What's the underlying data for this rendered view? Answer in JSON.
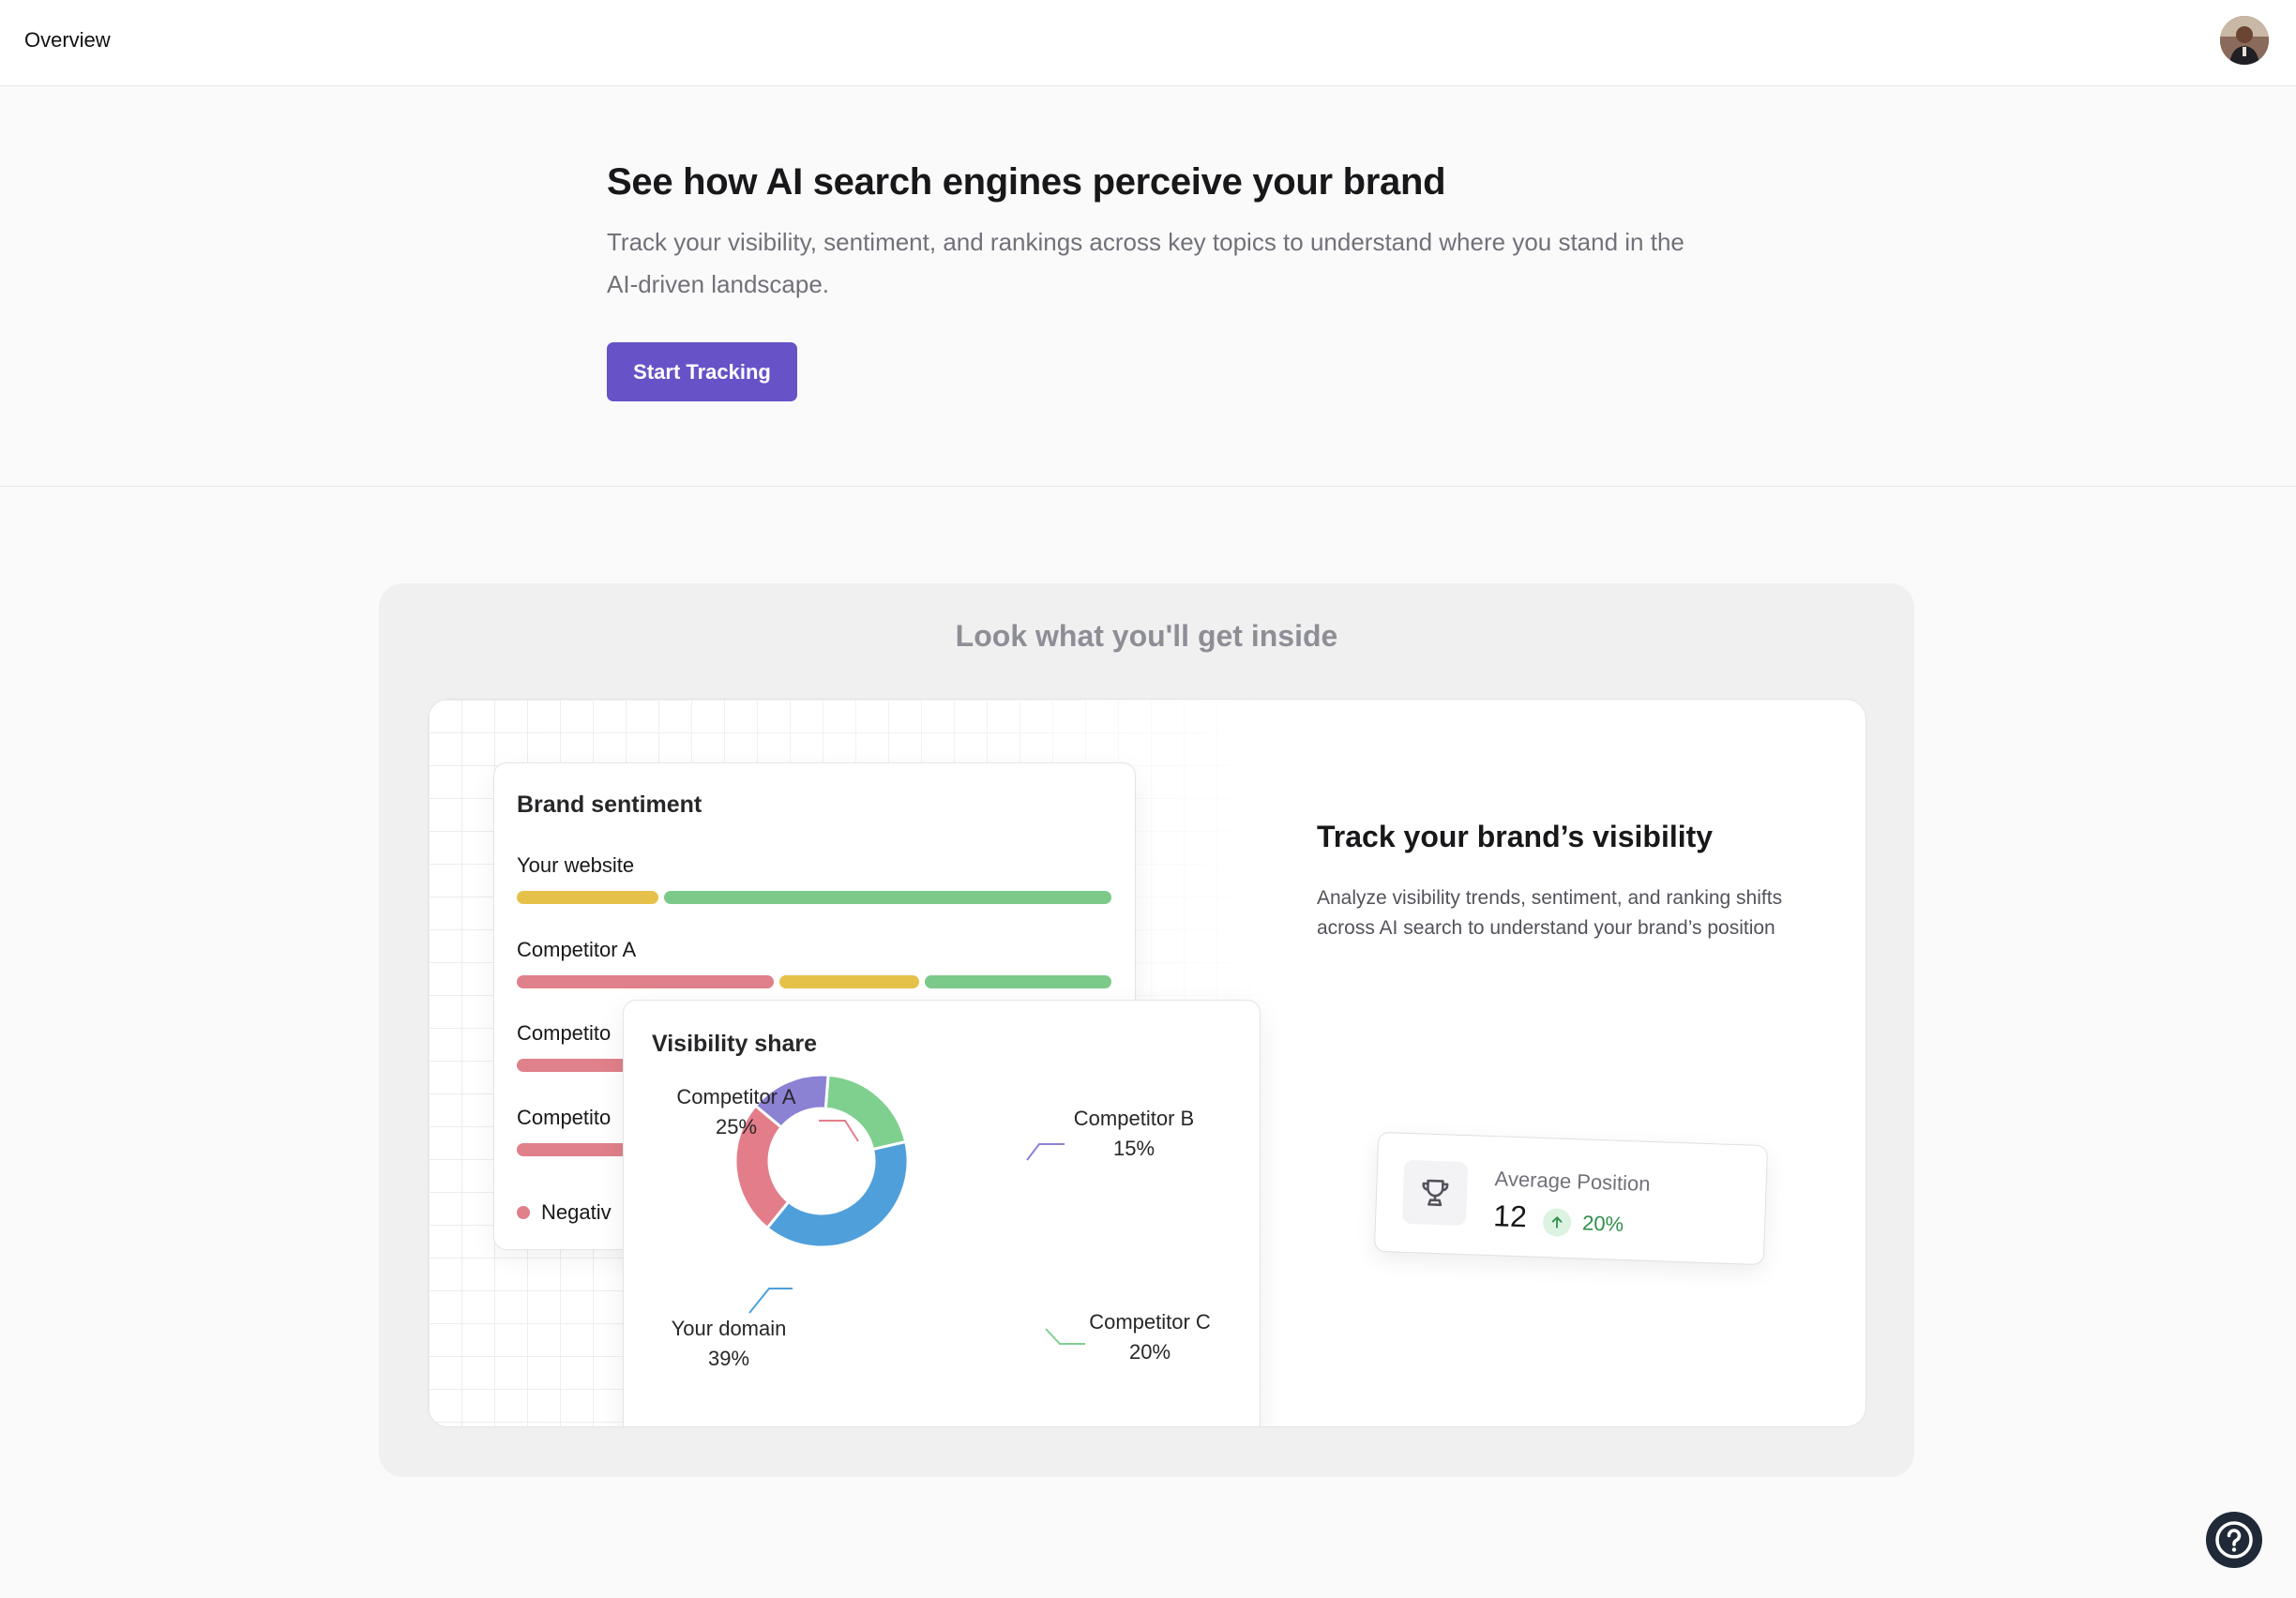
{
  "topbar": {
    "title": "Overview",
    "avatar_icon": "user-avatar"
  },
  "hero": {
    "title": "See how AI search engines perceive your brand",
    "subtitle": "Track your visibility, sentiment, and rankings across key topics to understand where you stand in the AI-driven landscape.",
    "cta_label": "Start Tracking",
    "cta_color": "#6752c8"
  },
  "preview": {
    "heading": "Look what you'll get inside",
    "sentiment_card": {
      "title": "Brand sentiment",
      "rows": [
        {
          "label": "Your website",
          "segments": [
            {
              "sentiment": "neutral",
              "share": 0.24,
              "color": "#e6c14a"
            },
            {
              "sentiment": "positive",
              "share": 0.76,
              "color": "#7cc98a"
            }
          ]
        },
        {
          "label": "Competitor A",
          "segments": [
            {
              "sentiment": "negative",
              "share": 0.44,
              "color": "#e0808a"
            },
            {
              "sentiment": "neutral",
              "share": 0.24,
              "color": "#e6c14a"
            },
            {
              "sentiment": "positive",
              "share": 0.32,
              "color": "#7cc98a"
            }
          ]
        },
        {
          "label": "Competito",
          "segments": [
            {
              "sentiment": "negative",
              "share": 1.0,
              "color": "#e0808a"
            }
          ]
        },
        {
          "label": "Competito",
          "segments": [
            {
              "sentiment": "negative",
              "share": 1.0,
              "color": "#e0808a"
            }
          ]
        }
      ],
      "legend_label": "Negativ"
    },
    "visibility_card": {
      "title": "Visibility share"
    },
    "feature": {
      "title": "Track your brand’s visibility",
      "description": "Analyze visibility trends, sentiment, and ranking shifts across AI search to understand your brand’s position"
    },
    "average_position": {
      "label": "Average Position",
      "value": "12",
      "change": "20%",
      "icon": "trophy-icon",
      "trend_icon": "arrow-up-icon"
    }
  },
  "chart_data": {
    "type": "pie",
    "categories": [
      "Competitor A",
      "Competitor B",
      "Competitor C",
      "Your domain"
    ],
    "values": [
      25,
      15,
      20,
      39
    ],
    "value_labels": [
      "25%",
      "15%",
      "20%",
      "39%"
    ],
    "colors": [
      "#e47d8a",
      "#8b82d4",
      "#7fd08e",
      "#4f9fdb"
    ],
    "donut": true
  },
  "help": {
    "icon": "help-icon"
  }
}
